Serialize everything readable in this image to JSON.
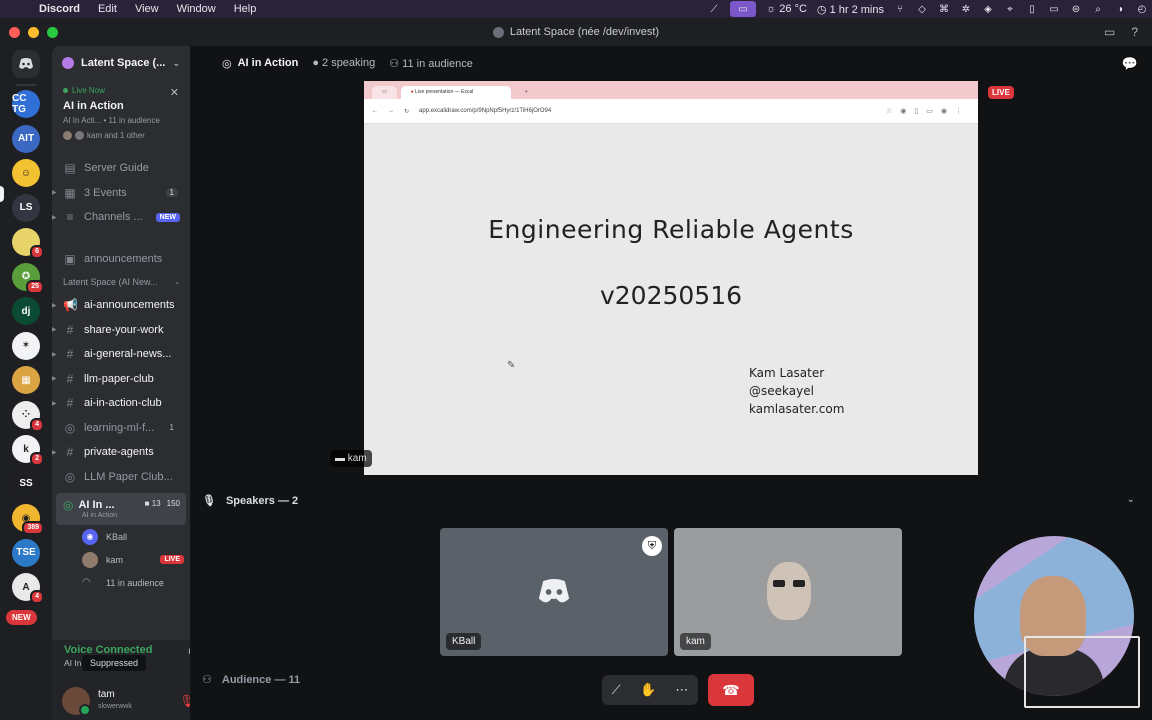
{
  "menubar": {
    "app": "Discord",
    "items": [
      "Edit",
      "View",
      "Window",
      "Help"
    ],
    "weather": "26 °C",
    "timer": "1 hr 2 mins"
  },
  "window": {
    "title": "Latent Space (née /dev/invest)"
  },
  "rail": {
    "servers": [
      {
        "label": "CC TG",
        "color": "#2f6fd6",
        "badge": ""
      },
      {
        "label": "AIT",
        "color": "#3b68c2",
        "badge": ""
      },
      {
        "label": "☺",
        "color": "#f2c233",
        "badge": ""
      },
      {
        "label": "LS",
        "color": "#333640",
        "badge": ""
      },
      {
        "label": "",
        "color": "#e8d36a",
        "badge": "6"
      },
      {
        "label": "✪",
        "color": "#5a9e3c",
        "badge": "25"
      },
      {
        "label": "dj",
        "color": "#0c4b33",
        "badge": ""
      },
      {
        "label": "✶",
        "color": "#f2f3f5",
        "badge": ""
      },
      {
        "label": "▦",
        "color": "#d9a441",
        "badge": ""
      },
      {
        "label": "⁘",
        "color": "#eeeeee",
        "badge": "4"
      },
      {
        "label": "k",
        "color": "#f2f3f5",
        "badge": "2"
      },
      {
        "label": "SS",
        "color": "#1e1f22",
        "badge": ""
      },
      {
        "label": "◉",
        "color": "#f0b62f",
        "badge": "389"
      },
      {
        "label": "TSE",
        "color": "#2c79c7",
        "badge": ""
      },
      {
        "label": "A",
        "color": "#e9e9e9",
        "badge": "4"
      }
    ],
    "new_label": "NEW"
  },
  "sidebar": {
    "guild_name": "Latent Space (...",
    "live": {
      "status": "Live Now",
      "title": "AI in Action",
      "sub": "AI In Acti... • 11 in audience",
      "people": "kam and 1 other"
    },
    "items": [
      {
        "icon": "▤",
        "label": "Server Guide",
        "count": "",
        "tag": "",
        "bright": false
      },
      {
        "icon": "▦",
        "label": "3 Events",
        "count": "1",
        "tag": "",
        "bright": false
      },
      {
        "icon": "≡",
        "label": "Channels ...",
        "count": "",
        "tag": "NEW",
        "bright": false
      },
      {
        "icon": "▣",
        "label": "announcements",
        "count": "",
        "tag": "",
        "bright": false
      }
    ],
    "category": "Latent Space (AI New...",
    "channels": [
      {
        "icon": "📢",
        "label": "ai-announcements",
        "bright": true,
        "count": ""
      },
      {
        "icon": "#",
        "label": "share-your-work",
        "bright": true,
        "count": ""
      },
      {
        "icon": "#",
        "label": "ai-general-news...",
        "bright": true,
        "count": ""
      },
      {
        "icon": "#",
        "label": "llm-paper-club",
        "bright": true,
        "count": ""
      },
      {
        "icon": "#",
        "label": "ai-in-action-club",
        "bright": true,
        "count": ""
      },
      {
        "icon": "◎",
        "label": "learning-ml-f...",
        "bright": false,
        "count": "1"
      },
      {
        "icon": "#",
        "label": "private-agents",
        "bright": true,
        "count": ""
      },
      {
        "icon": "◎",
        "label": "LLM Paper Club...",
        "bright": false,
        "count": ""
      }
    ],
    "active_vc": {
      "name": "AI In ...",
      "sub": "AI in Action",
      "video": "13",
      "listeners": "150"
    },
    "vc_users": [
      {
        "name": "KBall",
        "live": ""
      },
      {
        "name": "kam",
        "live": "LIVE"
      }
    ],
    "audience": "11 in audience"
  },
  "voice": {
    "status": "Voice Connected",
    "location": "AI In Action - Fri...",
    "tooltip": "Suppressed"
  },
  "user": {
    "name": "tam",
    "status": "slowerwwk"
  },
  "stage": {
    "name": "AI in Action",
    "speaking": "2 speaking",
    "audience": "11 in audience",
    "live_badge": "LIVE",
    "stream_owner": "kam",
    "browser": {
      "tab": "Live presentation — Excal",
      "url": "app.excalidraw.com/p/9NpNpf5Hyrz/1TiH6jOrO94"
    },
    "slide": {
      "title": "Engineering Reliable Agents",
      "version": "v20250516",
      "author_lines": [
        "Kam Lasater",
        "@seekayel",
        "kamlasater.com"
      ]
    },
    "speakers_header": "Speakers — 2",
    "speakers": [
      {
        "name": "KBall"
      },
      {
        "name": "kam"
      }
    ],
    "audience_header": "Audience — 11"
  }
}
